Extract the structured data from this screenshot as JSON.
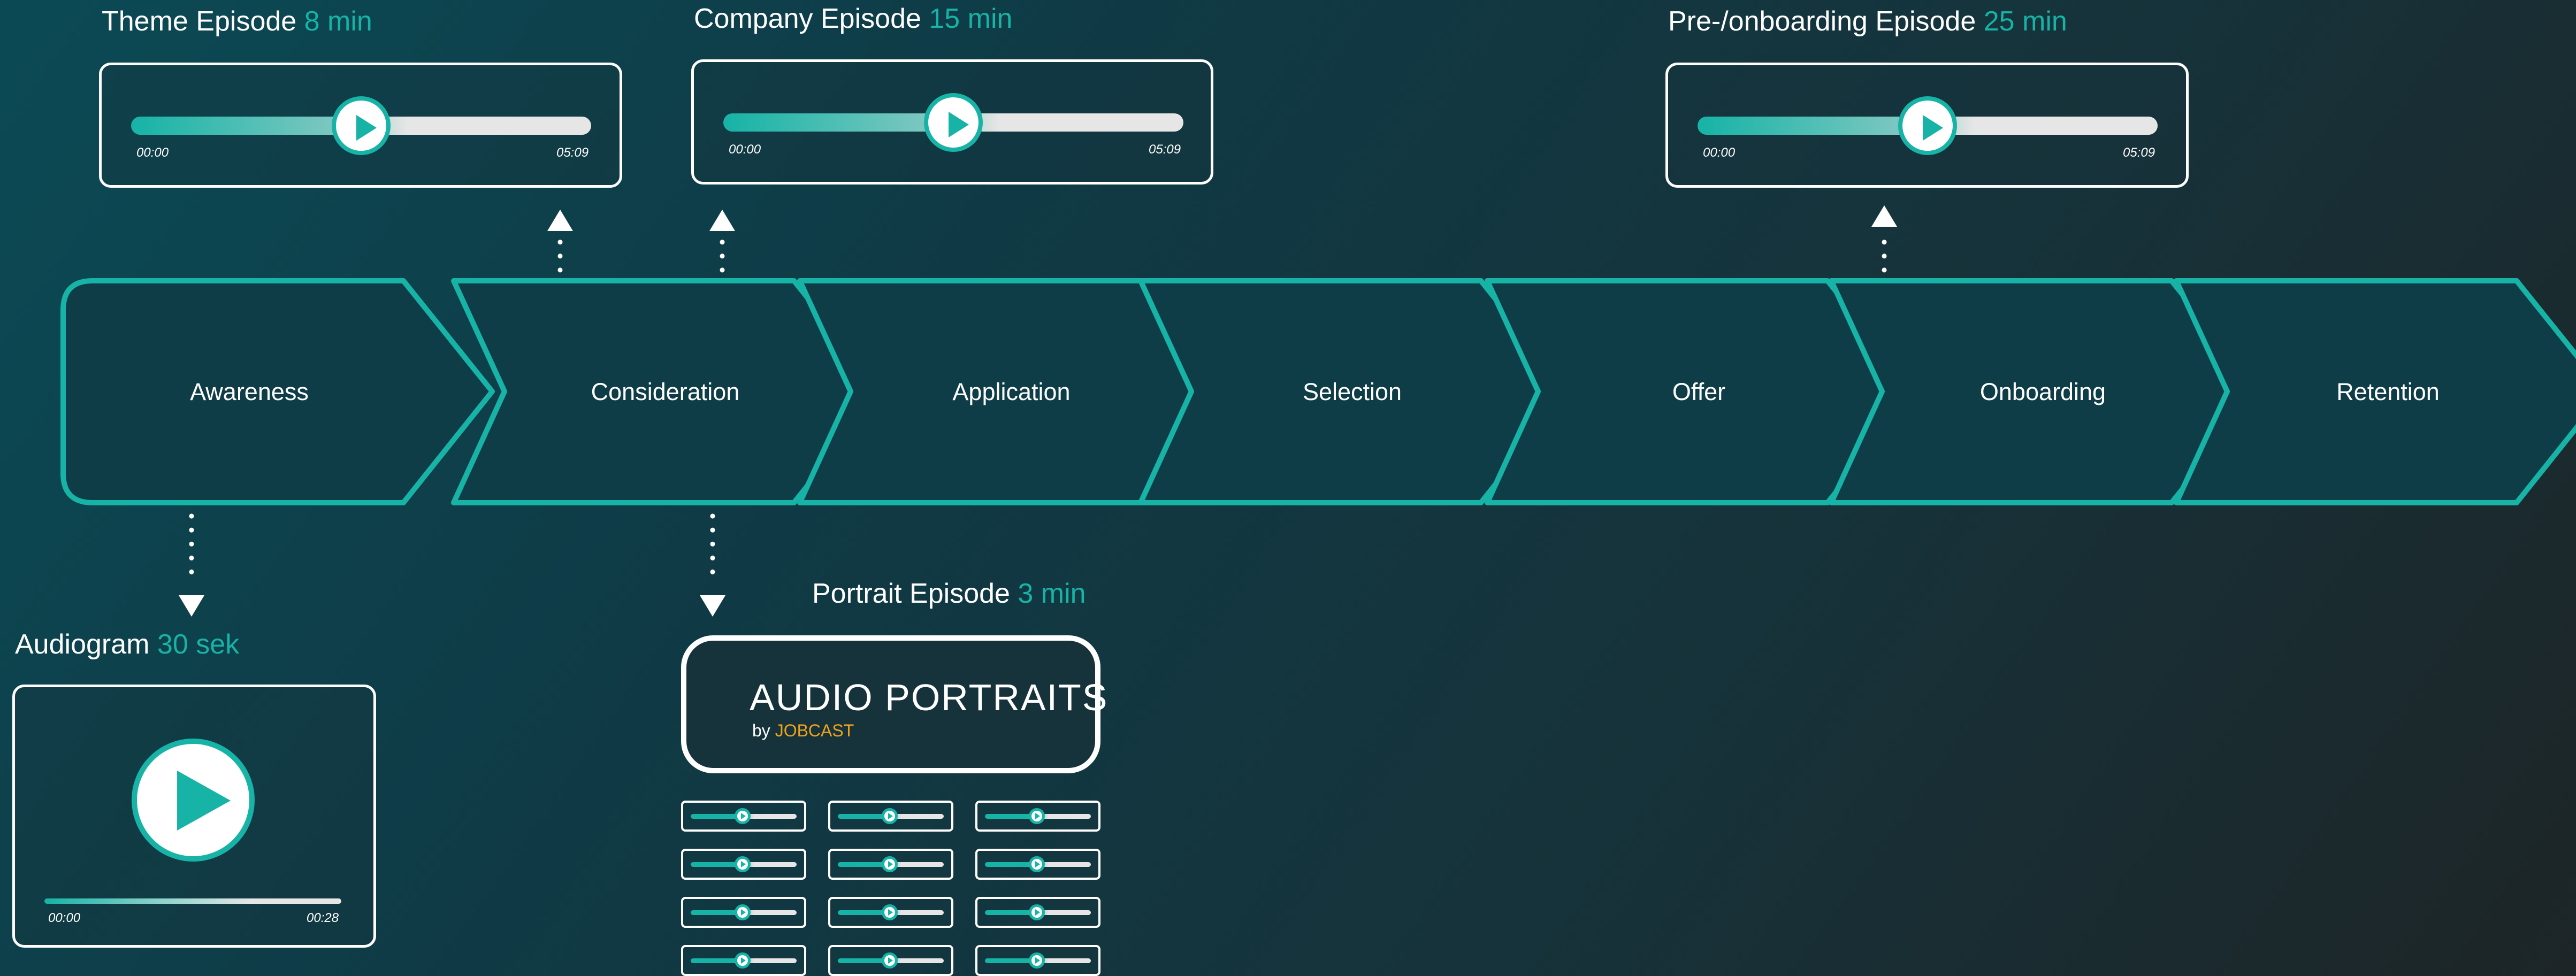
{
  "colors": {
    "accent": "#16b3a6",
    "white": "#ffffff",
    "orange": "#f0a21d"
  },
  "stages": [
    "Awareness",
    "Consideration",
    "Application",
    "Selection",
    "Offer",
    "Onboarding",
    "Retention"
  ],
  "episodes": {
    "theme": {
      "name": "Theme Episode",
      "duration": "8 min",
      "start": "00:00",
      "end": "05:09",
      "progress": 0.5
    },
    "company": {
      "name": "Company Episode",
      "duration": "15 min",
      "start": "00:00",
      "end": "05:09",
      "progress": 0.5
    },
    "onboarding": {
      "name": "Pre-/onboarding Episode",
      "duration": "25 min",
      "start": "00:00",
      "end": "05:09",
      "progress": 0.5
    },
    "audiogram": {
      "name": "Audiogram",
      "duration": "30 sek",
      "start": "00:00",
      "end": "00:28",
      "progress": 1.0
    },
    "portrait": {
      "name": "Portrait Episode",
      "duration": "3 min"
    }
  },
  "portraits_card": {
    "title": "AUDIO PORTRAITS",
    "by": "by",
    "brand": "JOBCAST"
  },
  "portrait_players": {
    "rows": 4,
    "cols": 3,
    "icon": "play-icon"
  }
}
